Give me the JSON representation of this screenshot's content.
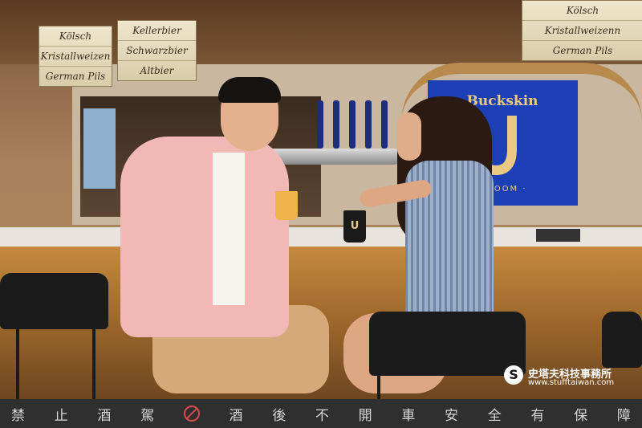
{
  "scene": {
    "signs_left": [
      "Kölsch",
      "Kristallweizen",
      "German Pils"
    ],
    "signs_center": [
      "Kellerbier",
      "Schwarzbier",
      "Altbier"
    ],
    "signs_right": [
      "Kölsch",
      "Kristallweizenn",
      "German Pils"
    ],
    "brand_name": "Buckskin",
    "taproom_label": "APROOM ·",
    "cup_logo": "U"
  },
  "watermark": {
    "logo": "S",
    "name": "史塔夫科技事務所",
    "url": "www.stufftaiwan.com"
  },
  "banner": {
    "chars": [
      "禁",
      "止",
      "酒",
      "駕",
      "",
      "酒",
      "後",
      "不",
      "開",
      "車",
      "安",
      "全",
      "有",
      "保",
      "障"
    ],
    "icon": "no-drinking-icon"
  },
  "colors": {
    "panel_blue": "#1d3fb6",
    "brand_gold": "#e9c984",
    "banner_bg": "#2f2f2f"
  }
}
